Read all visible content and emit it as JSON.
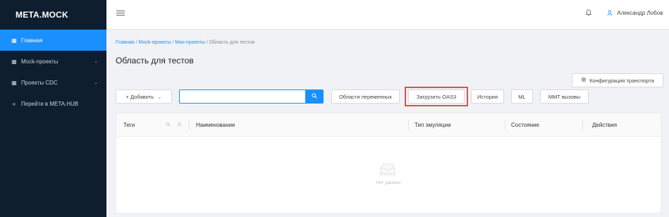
{
  "sidebar": {
    "logo": "META.MOCK",
    "items": [
      {
        "label": "Главная",
        "icon": "grid-icon"
      },
      {
        "label": "Mock-проекты",
        "icon": "grid-icon"
      },
      {
        "label": "Проекты CDC",
        "icon": "grid-icon"
      },
      {
        "label": "Перейти в META.HUB",
        "icon": "double-chevron-left-icon"
      }
    ],
    "chevron": "⌄",
    "back_glyph": "«"
  },
  "topbar": {
    "bell_glyph": "🔔",
    "user_glyph": "☺",
    "user_name": "Александр Лобов"
  },
  "breadcrumb": {
    "items": [
      "Главная",
      "Mock-проекты",
      "Мои проекты"
    ],
    "current": "Область для тестов",
    "separator": " / "
  },
  "page": {
    "title": "Область для тестов"
  },
  "toolbar": {
    "transport_config": "Конфигурация транспорта",
    "add": "+ Добавить",
    "add_caret": "⌄",
    "search_value": "",
    "search_placeholder": "",
    "variable_areas": "Области переменных",
    "upload_oas3": "Загрузить OAS3",
    "history": "История",
    "ml": "ML",
    "mmt_calls": "MMT вызовы"
  },
  "table": {
    "columns": [
      "Теги",
      "Наименование",
      "Тип эмуляции",
      "Состояние",
      "Действия"
    ],
    "tag_filter_icons": [
      "search-icon",
      "close-icon"
    ],
    "rows": [],
    "empty_text": "Нет данных"
  },
  "colors": {
    "sidebar_bg": "#0f1e2e",
    "accent": "#1a90ff",
    "highlight": "#d9534f",
    "page_bg": "#f0f2f5"
  }
}
